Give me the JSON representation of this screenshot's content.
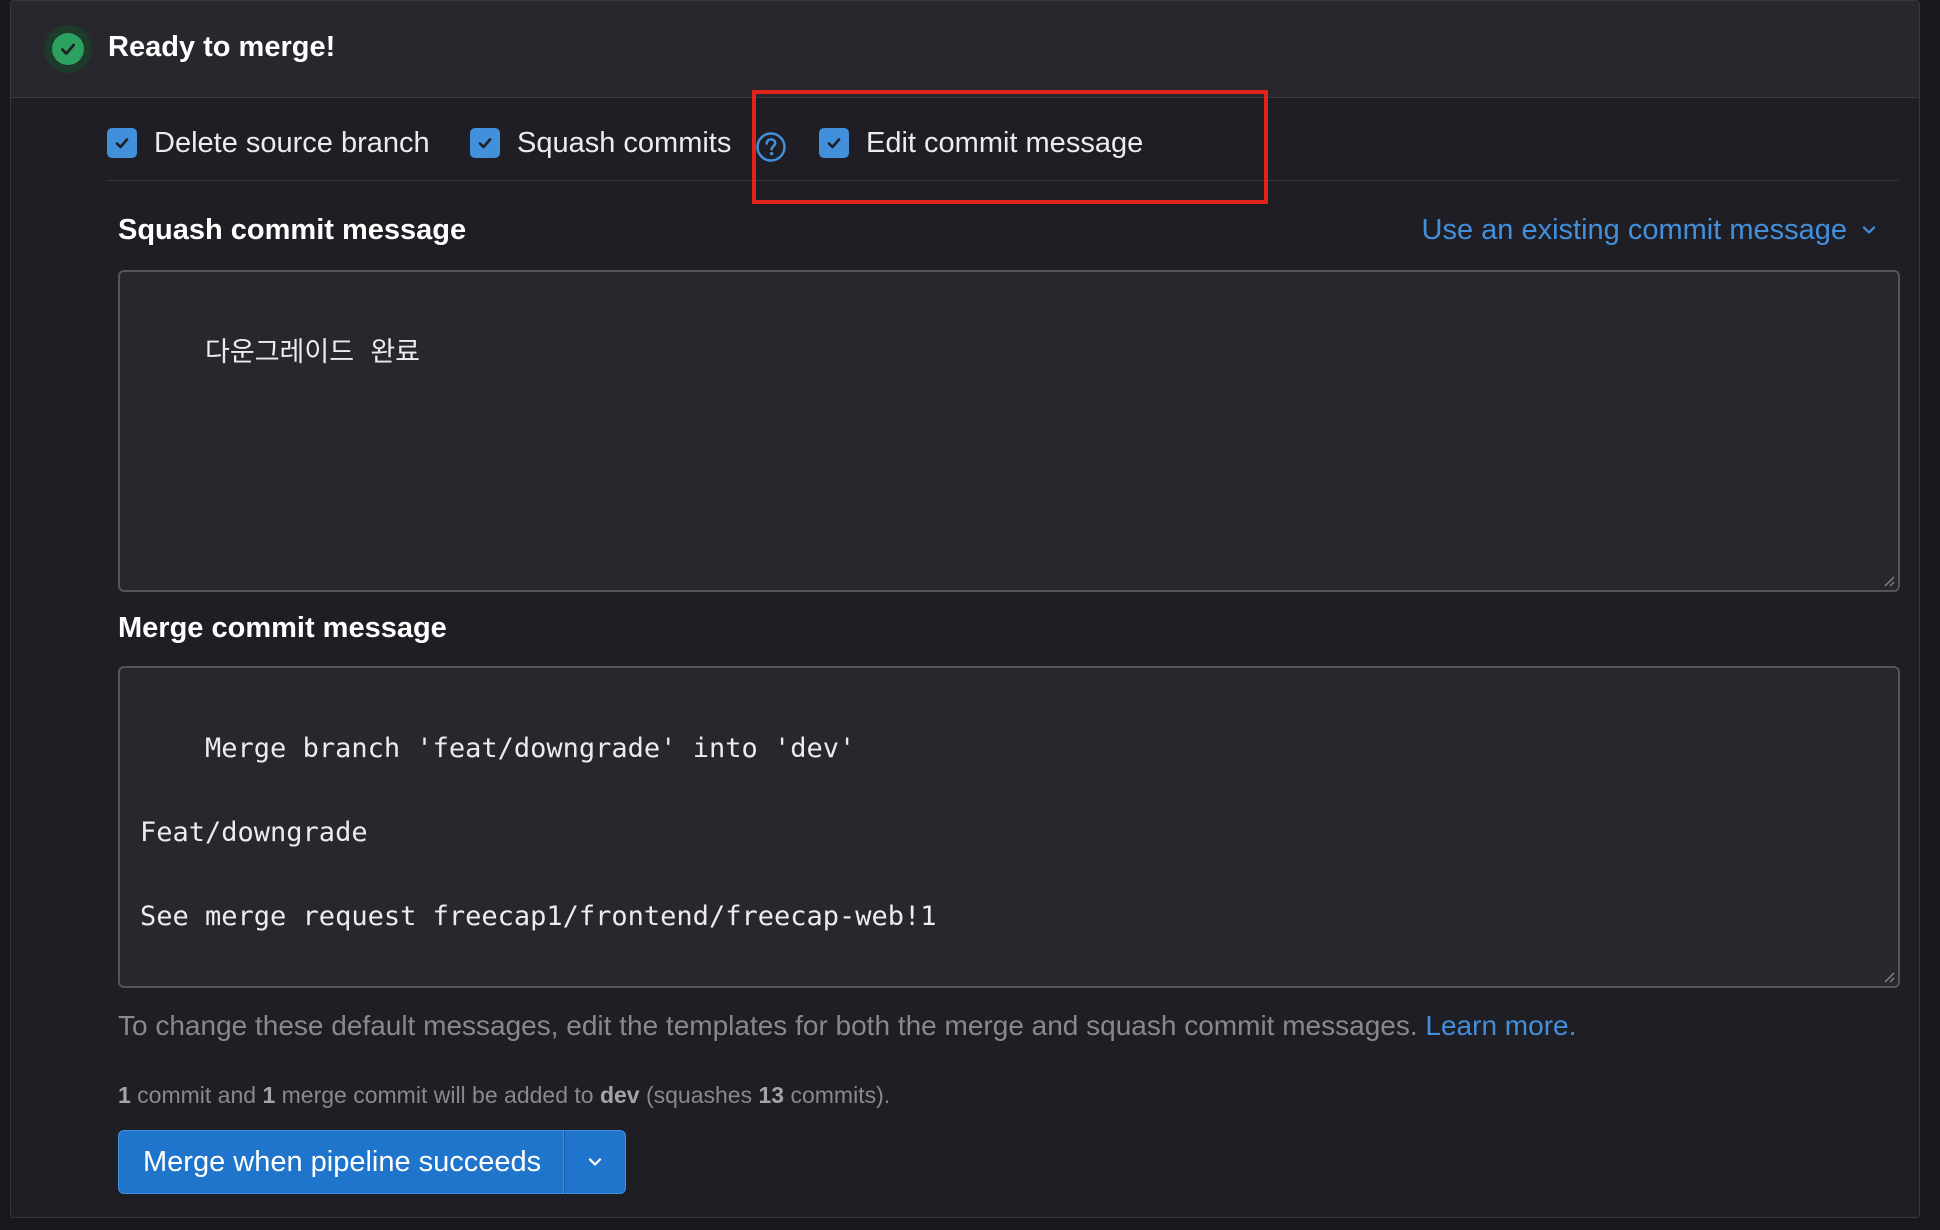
{
  "header": {
    "title": "Ready to merge!",
    "status_icon": "check-circle-icon",
    "status_color": "#2da160"
  },
  "options": [
    {
      "label": "Delete source branch",
      "checked": true
    },
    {
      "label": "Squash commits",
      "checked": true,
      "help_icon": "question-circle-icon"
    },
    {
      "label": "Edit commit message",
      "checked": true
    }
  ],
  "squash": {
    "label": "Squash commit message",
    "existing_link": "Use an existing commit message",
    "value": "다운그레이드 완료"
  },
  "merge_message": {
    "label": "Merge commit message",
    "value": "Merge branch 'feat/downgrade' into 'dev'\n\nFeat/downgrade\n\nSee merge request freecap1/frontend/freecap-web!1"
  },
  "helper": {
    "text": "To change these default messages, edit the templates for both the merge and squash commit messages. ",
    "link": "Learn more."
  },
  "summary": {
    "commit_count": "1",
    "text_a": " commit and ",
    "merge_commit_count": "1",
    "text_b": " merge commit will be added to ",
    "target_branch": "dev",
    "text_c": " (squashes ",
    "squashed_count": "13",
    "text_d": " commits)."
  },
  "merge_button": {
    "label": "Merge when pipeline succeeds",
    "toggle_icon": "chevron-down-icon"
  },
  "colors": {
    "accent": "#428fdc",
    "highlight": "#e0241b",
    "button": "#1f75cb"
  }
}
